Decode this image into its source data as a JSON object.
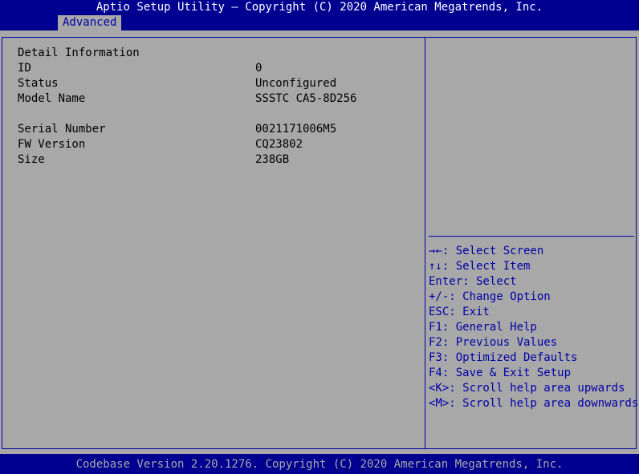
{
  "header": {
    "title": "Aptio Setup Utility – Copyright (C) 2020 American Megatrends, Inc."
  },
  "tabs": [
    {
      "label": "Advanced",
      "active": true
    }
  ],
  "detail": {
    "heading": "Detail Information",
    "rows": [
      {
        "label": "ID",
        "value": "0"
      },
      {
        "label": "Status",
        "value": "Unconfigured"
      },
      {
        "label": "Model Name",
        "value": "SSSTC CA5-8D256"
      },
      {
        "label": "Serial Number",
        "value": "0021171006M5"
      },
      {
        "label": "FW Version",
        "value": "CQ23802"
      },
      {
        "label": "Size",
        "value": "238GB"
      }
    ]
  },
  "help": {
    "lines": [
      "→←: Select Screen",
      "↑↓: Select Item",
      "Enter: Select",
      "+/-: Change Option",
      "ESC: Exit",
      "F1: General Help",
      "F2: Previous Values",
      "F3: Optimized Defaults",
      "F4: Save & Exit Setup",
      "<K>: Scroll help area upwards",
      "<M>: Scroll help area downwards"
    ]
  },
  "footer": {
    "text": "Codebase Version 2.20.1276. Copyright (C) 2020 American Megatrends, Inc."
  },
  "colors": {
    "background_blue": "#000090",
    "panel_gray": "#a8a8a8",
    "frame_blue": "#0000a8",
    "text_white": "#ffffff",
    "text_black": "#000000"
  }
}
